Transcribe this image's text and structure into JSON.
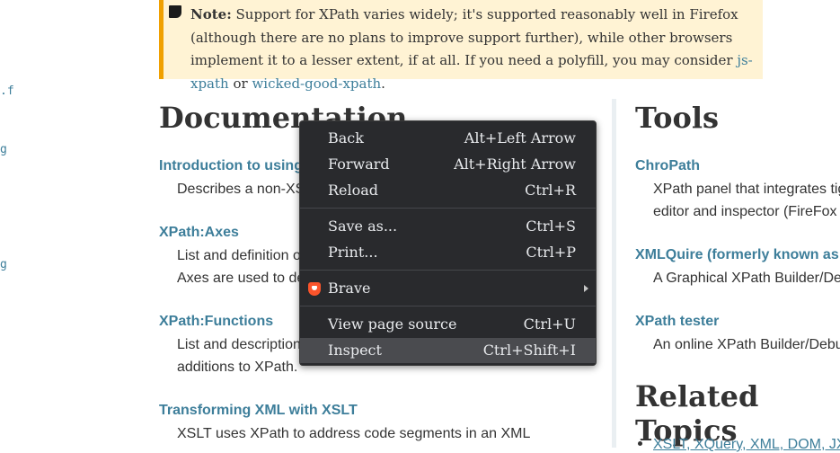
{
  "left_fragments": [
    ".f",
    "g",
    "g"
  ],
  "note": {
    "label": "Note:",
    "text_before": " Support for XPath varies widely; it's supported reasonably well in Firefox (although there are no plans to improve support further), while other browsers implement it to a lesser extent, if at all. If you need a polyfill, you may consider ",
    "link1": "js-xpath",
    "middle": " or ",
    "link2": "wicked-good-xpath",
    "end": "."
  },
  "documentation": {
    "heading": "Documentation",
    "items": [
      {
        "title": "Introduction to using",
        "desc": [
          "Describes a non-XS"
        ]
      },
      {
        "title": "XPath:Axes",
        "desc": [
          "List and definition o",
          "Axes are used to de"
        ]
      },
      {
        "title": "XPath:Functions",
        "desc": [
          "List and description",
          "additions to XPath."
        ]
      },
      {
        "title": "Transforming XML with XSLT",
        "desc": [
          "XSLT uses XPath to address code segments in an XML"
        ]
      }
    ]
  },
  "tools": {
    "heading": "Tools",
    "items": [
      {
        "title": "ChroPath",
        "desc": [
          "XPath panel that integrates tig",
          "editor and inspector (FireFox /"
        ]
      },
      {
        "title": "XMLQuire (formerly known as",
        "desc": [
          "A Graphical XPath Builder/De"
        ]
      },
      {
        "title": "XPath tester",
        "desc": [
          "An online XPath Builder/Debu"
        ]
      }
    ]
  },
  "related": {
    "heading": "Related Topics",
    "link": "XSLT, XQuery, XML, DOM, JX"
  },
  "context_menu": {
    "items": [
      {
        "label": "Back",
        "shortcut": "Alt+Left Arrow"
      },
      {
        "label": "Forward",
        "shortcut": "Alt+Right Arrow"
      },
      {
        "label": "Reload",
        "shortcut": "Ctrl+R"
      },
      {
        "label": "Save as...",
        "shortcut": "Ctrl+S"
      },
      {
        "label": "Print...",
        "shortcut": "Ctrl+P"
      },
      {
        "label": "Brave",
        "shortcut": ""
      },
      {
        "label": "View page source",
        "shortcut": "Ctrl+U"
      },
      {
        "label": "Inspect",
        "shortcut": "Ctrl+Shift+I"
      }
    ],
    "colors": {
      "background": "#292a2d",
      "active": "#4a4b4f",
      "text": "#e8eaed"
    }
  }
}
